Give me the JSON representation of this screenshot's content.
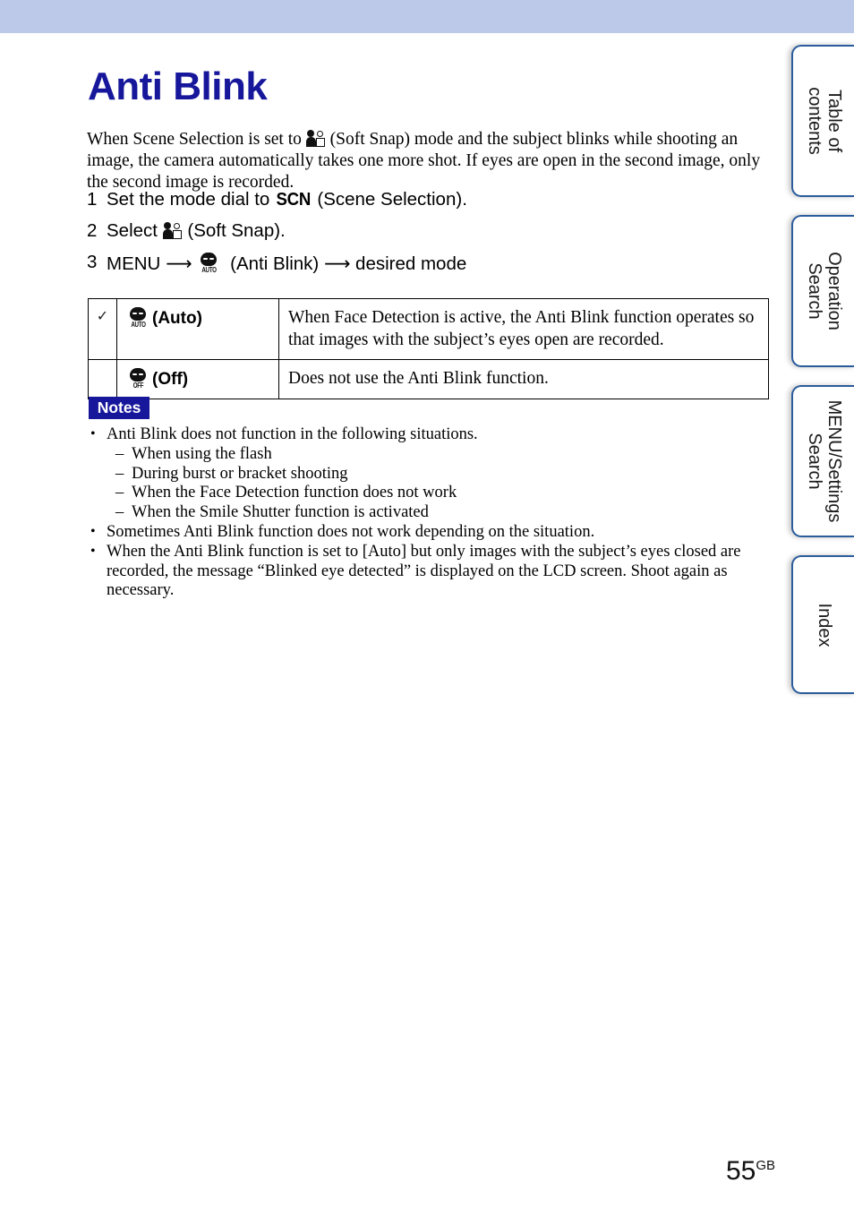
{
  "header": {
    "band_color": "#bdc9e8"
  },
  "page": {
    "title": "Anti Blink",
    "title_color": "#17179b",
    "number": "55",
    "number_suffix": "GB"
  },
  "intro": {
    "text_before_icon": "When Scene Selection is set to ",
    "icon": "soft-snap-icon",
    "text_after_icon": " (Soft Snap) mode and the subject blinks while shooting an image, the camera automatically takes one more shot. If eyes are open in the second image, only the second image is recorded."
  },
  "steps": [
    {
      "number": "1",
      "parts": [
        {
          "type": "text",
          "value": "Set the mode dial to "
        },
        {
          "type": "scn",
          "value": "SCN"
        },
        {
          "type": "text",
          "value": " (Scene Selection)."
        }
      ],
      "plain": "Set the mode dial to SCN (Scene Selection)."
    },
    {
      "number": "2",
      "parts": [
        {
          "type": "text",
          "value": "Select "
        },
        {
          "type": "icon",
          "value": "soft-snap-icon"
        },
        {
          "type": "text",
          "value": " (Soft Snap)."
        }
      ],
      "plain": "Select (Soft Snap)."
    },
    {
      "number": "3",
      "parts": [
        {
          "type": "text",
          "value": "MENU "
        },
        {
          "type": "arrow",
          "value": "⟶"
        },
        {
          "type": "icon",
          "value": "anti-blink-auto-icon"
        },
        {
          "type": "text",
          "value": " (Anti Blink) "
        },
        {
          "type": "arrow",
          "value": "⟶"
        },
        {
          "type": "text",
          "value": " desired mode"
        }
      ],
      "plain": "MENU ⟶ (Anti Blink) ⟶ desired mode"
    }
  ],
  "step_text": {
    "s1_a": "Set the mode dial to ",
    "s1_scn": "SCN",
    "s1_b": " (Scene Selection).",
    "s2_a": "Select ",
    "s2_b": " (Soft Snap).",
    "s3_a": "MENU ",
    "s3_arrow1": "⟶",
    "s3_b": " (Anti Blink) ",
    "s3_arrow2": "⟶",
    "s3_c": " desired mode"
  },
  "mode_table": {
    "rows": [
      {
        "checked": true,
        "check_glyph": "✓",
        "icon": "anti-blink-auto-icon",
        "icon_sub": "AUTO",
        "label": "(Auto)",
        "description": "When Face Detection is active, the Anti Blink function operates so that images with the subject’s eyes open are recorded."
      },
      {
        "checked": false,
        "check_glyph": "",
        "icon": "anti-blink-off-icon",
        "icon_sub": "OFF",
        "label": "(Off)",
        "description": "Does not use the Anti Blink function."
      }
    ]
  },
  "notes": {
    "badge_label": "Notes",
    "badge_color": "#17179b",
    "items": [
      {
        "bullet": "•",
        "text": "Anti Blink does not function in the following situations.",
        "subitems": [
          {
            "dash": "–",
            "text": "When using the flash"
          },
          {
            "dash": "–",
            "text": "During burst or bracket shooting"
          },
          {
            "dash": "–",
            "text": "When the Face Detection function does not work"
          },
          {
            "dash": "–",
            "text": "When the Smile Shutter function is activated"
          }
        ]
      },
      {
        "bullet": "•",
        "text": "Sometimes Anti Blink function does not work depending on the situation.",
        "subitems": []
      },
      {
        "bullet": "•",
        "text": "When the Anti Blink function is set to [Auto] but only images with the subject’s eyes closed are recorded, the message “Blinked eye detected” is displayed on the LCD screen. Shoot again as necessary.",
        "subitems": []
      }
    ]
  },
  "side_tabs": [
    {
      "id": "table-of-contents",
      "line1": "Table of",
      "line2": "contents"
    },
    {
      "id": "operation-search",
      "line1": "Operation",
      "line2": "Search"
    },
    {
      "id": "menu-settings-search",
      "line1": "MENU/Settings",
      "line2": "Search"
    },
    {
      "id": "index",
      "line1": "Index",
      "line2": ""
    }
  ]
}
